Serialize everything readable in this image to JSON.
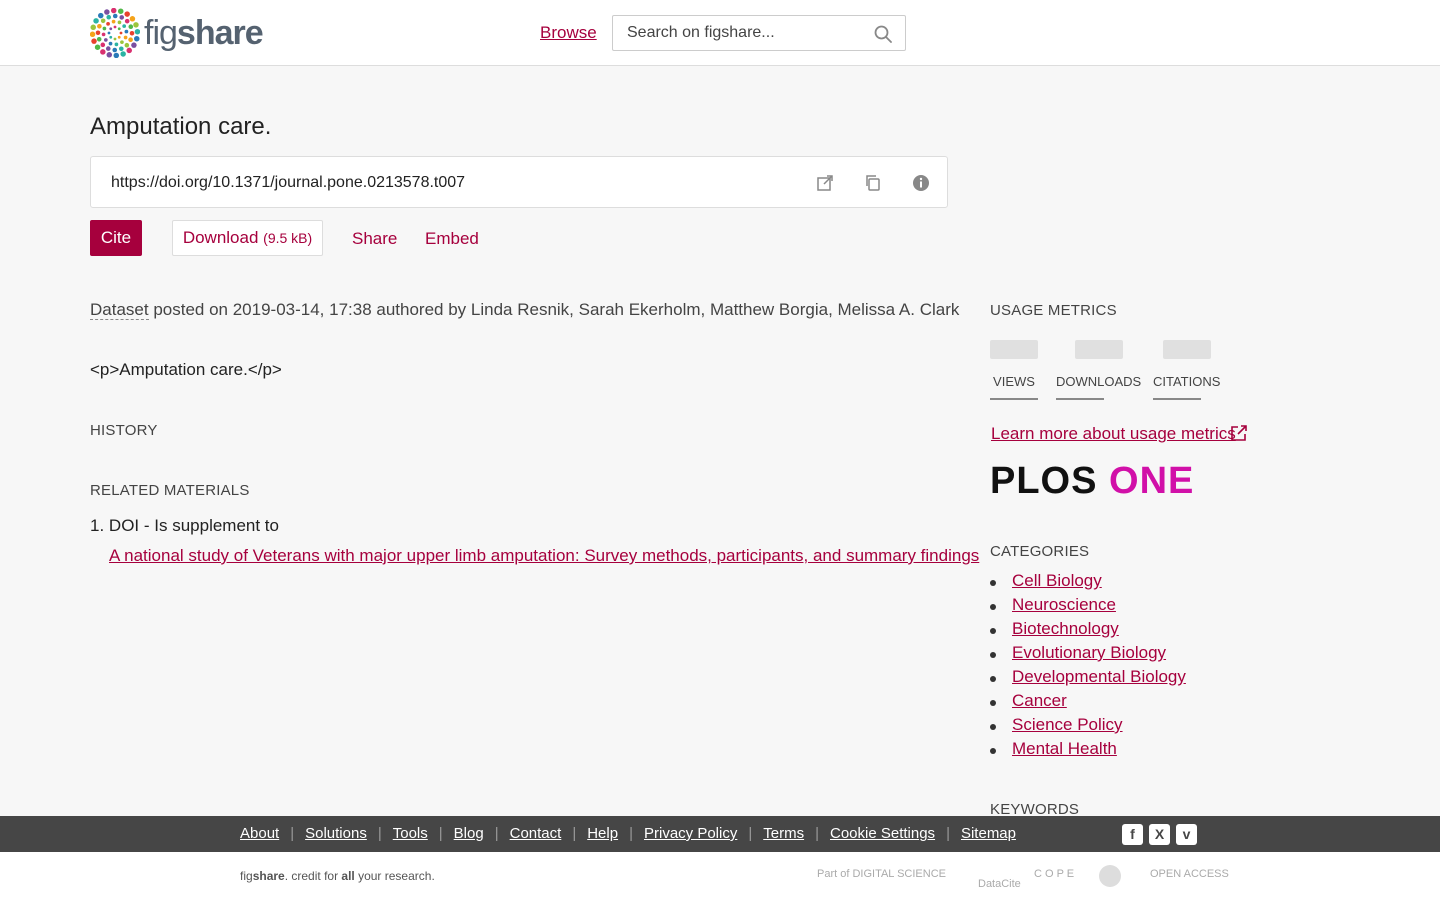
{
  "header": {
    "logo_text_light": "fig",
    "logo_text_bold": "share",
    "browse_label": "Browse",
    "search_placeholder": "Search on figshare..."
  },
  "article": {
    "title": "Amputation care.",
    "doi": "https://doi.org/10.1371/journal.pone.0213578.t007",
    "actions": {
      "cite": "Cite",
      "download": "Download",
      "download_size": "(9.5 kB)",
      "share": "Share",
      "embed": "Embed"
    },
    "item_type": "Dataset",
    "posted_text": " posted on 2019-03-14, 17:38 authored by Linda Resnik, Sarah Ekerholm, Matthew Borgia, Melissa A. Clark",
    "description": "<p>Amputation care.</p>",
    "history_heading": "HISTORY",
    "related_heading": "RELATED MATERIALS",
    "related": [
      {
        "number": "1.",
        "relation": "DOI - Is supplement to",
        "link_text": "A national study of Veterans with major upper limb amputation: Survey methods, participants, and summary findings"
      }
    ]
  },
  "sidebar": {
    "usage_heading": "USAGE METRICS",
    "metrics": [
      "VIEWS",
      "DOWNLOADS",
      "CITATIONS"
    ],
    "learn_more": "Learn more about usage metrics",
    "publisher_part1": "PLOS",
    "publisher_part2": "ONE",
    "categories_heading": "CATEGORIES",
    "categories": [
      "Cell Biology",
      "Neuroscience",
      "Biotechnology",
      "Evolutionary Biology",
      "Developmental Biology",
      "Cancer",
      "Science Policy",
      "Mental Health"
    ],
    "keywords_heading": "KEYWORDS"
  },
  "footer": {
    "links": [
      "About",
      "Solutions",
      "Tools",
      "Blog",
      "Contact",
      "Help",
      "Privacy Policy",
      "Terms",
      "Cookie Settings",
      "Sitemap"
    ],
    "social": [
      "f",
      "X",
      "v"
    ],
    "tagline_pre": "fig",
    "tagline_bold": "share",
    "tagline_mid": ". credit for ",
    "tagline_all": "all",
    "tagline_end": " your research.",
    "partners": [
      "Part of DIGITAL SCIENCE",
      "DataCite",
      "C O P E",
      "OPEN ACCESS"
    ]
  },
  "colors": {
    "accent": "#a6003d",
    "plos_pink": "#d110a8",
    "footer_bg": "#464646"
  }
}
